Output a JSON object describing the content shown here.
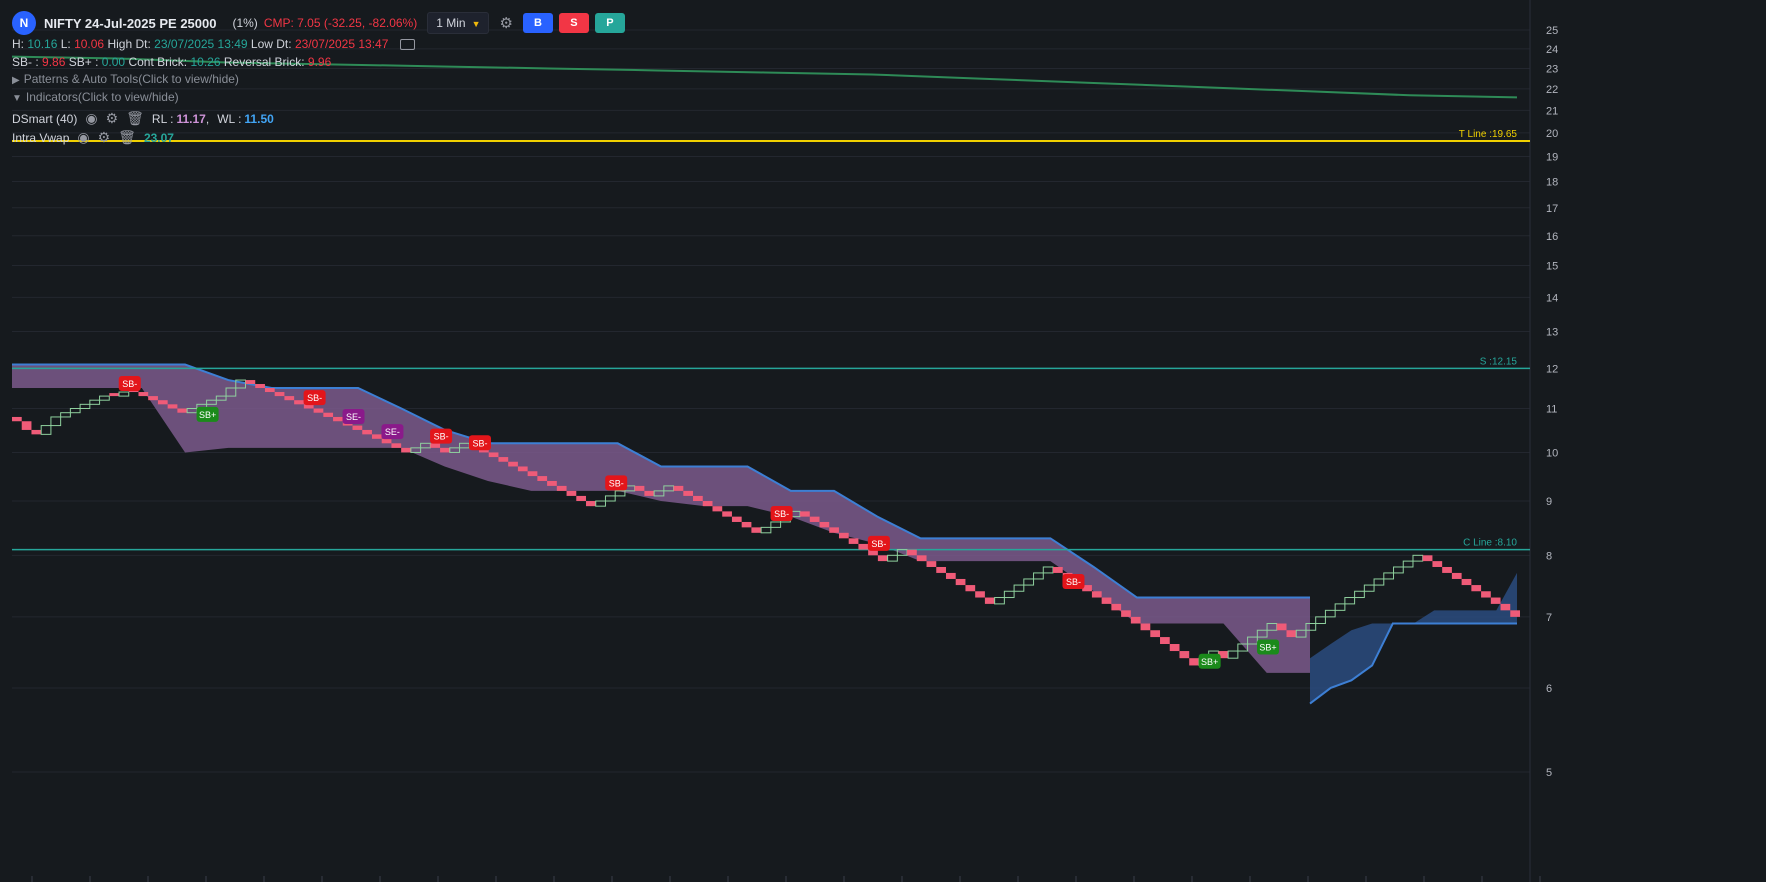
{
  "header": {
    "logo_letter": "N",
    "symbol": "NIFTY 24-Jul-2025 PE 25000",
    "percent": "(1%)",
    "cmp": "CMP: 7.05 (-32.25, -82.06%)",
    "timeframe": "1 Min",
    "buttons": [
      "B",
      "S",
      "P"
    ]
  },
  "stats": {
    "h_label": "H:",
    "h_value": "10.16",
    "l_label": "L:",
    "l_value": "10.06",
    "high_dt_label": "High Dt:",
    "high_dt_value": "23/07/2025 13:49",
    "low_dt_label": "Low Dt:",
    "low_dt_value": "23/07/2025 13:47"
  },
  "bricks": {
    "sb_minus_label": "SB- :",
    "sb_minus_value": "9.86",
    "sb_plus_label": "SB+ :",
    "sb_plus_value": "0.00",
    "cont_label": "Cont Brick:",
    "cont_value": "10.26",
    "rev_label": "Reversal Brick:",
    "rev_value": "9.96"
  },
  "panels": {
    "patterns": "Patterns & Auto Tools(Click to view/hide)",
    "indicators": "Indicators(Click to view/hide)"
  },
  "indicators": [
    {
      "name": "DSmart (40)",
      "rl_label": "RL :",
      "rl_value": "11.17",
      "wl_label": "WL :",
      "wl_value": "11.50"
    },
    {
      "name": "Intra Vwap",
      "value": "23.07"
    }
  ],
  "colors": {
    "up": "#8fd19e",
    "down": "#ef5b78",
    "band": "#7b5a8c",
    "band_edge": "#3d7fd4",
    "vwap": "#2e8b57",
    "t_line": "#f0d000",
    "s_line": "#26a69a",
    "c_line": "#26a69a"
  },
  "chart_data": {
    "type": "line",
    "y_axis": {
      "min": 5,
      "max": 25,
      "scale": "log",
      "ticks": [
        5,
        6,
        7,
        8,
        9,
        10,
        11,
        12,
        13,
        14,
        15,
        16,
        17,
        18,
        19,
        20,
        21,
        22,
        23,
        24,
        25
      ]
    },
    "levels": [
      {
        "label": "T Line :19.65",
        "value": 19.65
      },
      {
        "label": "S :12.15",
        "value": 12.0
      },
      {
        "label": "C Line :8.10",
        "value": 8.1
      }
    ],
    "vwap": [
      23.6,
      23.5,
      23.3,
      23.2,
      23.1,
      23.0,
      22.9,
      22.8,
      22.7,
      22.5,
      22.3,
      22.1,
      21.9,
      21.7,
      21.6
    ],
    "renko": [
      10.7,
      10.5,
      10.4,
      10.6,
      10.8,
      10.9,
      11.0,
      11.1,
      11.2,
      11.3,
      11.3,
      11.4,
      11.4,
      11.3,
      11.2,
      11.1,
      11.0,
      10.9,
      11.0,
      11.1,
      11.2,
      11.3,
      11.5,
      11.7,
      11.6,
      11.5,
      11.4,
      11.3,
      11.2,
      11.1,
      11.0,
      10.9,
      10.8,
      10.7,
      10.6,
      10.5,
      10.4,
      10.3,
      10.2,
      10.1,
      10.0,
      10.1,
      10.2,
      10.1,
      10.0,
      10.1,
      10.2,
      10.1,
      10.0,
      9.9,
      9.8,
      9.7,
      9.6,
      9.5,
      9.4,
      9.3,
      9.2,
      9.1,
      9.0,
      8.9,
      9.0,
      9.1,
      9.2,
      9.3,
      9.2,
      9.1,
      9.2,
      9.3,
      9.2,
      9.1,
      9.0,
      8.9,
      8.8,
      8.7,
      8.6,
      8.5,
      8.4,
      8.5,
      8.6,
      8.7,
      8.8,
      8.7,
      8.6,
      8.5,
      8.4,
      8.3,
      8.2,
      8.1,
      8.0,
      7.9,
      8.0,
      8.1,
      8.0,
      7.9,
      7.8,
      7.7,
      7.6,
      7.5,
      7.4,
      7.3,
      7.2,
      7.3,
      7.4,
      7.5,
      7.6,
      7.7,
      7.8,
      7.7,
      7.6,
      7.5,
      7.4,
      7.3,
      7.2,
      7.1,
      7.0,
      6.9,
      6.8,
      6.7,
      6.6,
      6.5,
      6.4,
      6.3,
      6.4,
      6.5,
      6.4,
      6.5,
      6.6,
      6.7,
      6.8,
      6.9,
      6.8,
      6.7,
      6.8,
      6.9,
      7.0,
      7.1,
      7.2,
      7.3,
      7.4,
      7.5,
      7.6,
      7.7,
      7.8,
      7.9,
      8.0,
      7.9,
      7.8,
      7.7,
      7.6,
      7.5,
      7.4,
      7.3,
      7.2,
      7.1,
      7.0
    ],
    "band_upper": [
      12.1,
      12.1,
      12.1,
      12.1,
      12.1,
      11.7,
      11.5,
      11.5,
      11.5,
      11.0,
      10.5,
      10.2,
      10.2,
      10.2,
      10.2,
      9.7,
      9.7,
      9.7,
      9.2,
      9.2,
      8.7,
      8.3,
      8.3,
      8.3,
      8.3,
      7.8,
      7.3,
      7.3,
      7.3,
      7.3,
      7.3
    ],
    "band_lower": [
      11.5,
      11.5,
      11.5,
      11.5,
      10.0,
      10.1,
      10.1,
      10.1,
      10.1,
      10.1,
      9.7,
      9.4,
      9.2,
      9.2,
      9.2,
      9.0,
      8.9,
      8.9,
      8.7,
      8.4,
      8.2,
      7.9,
      7.9,
      7.9,
      7.9,
      7.4,
      6.9,
      6.9,
      6.9,
      6.2,
      6.2
    ],
    "band2_upper": [
      6.4,
      6.6,
      6.8,
      6.9,
      6.9,
      6.9,
      7.1,
      7.1,
      7.1,
      7.1,
      7.7
    ],
    "band2_lower": [
      5.8,
      6.0,
      6.1,
      6.3,
      6.9,
      6.9,
      6.9,
      6.9,
      6.9,
      6.9,
      6.9
    ],
    "signals": [
      {
        "label": "SB-",
        "type": "sell",
        "index": 12,
        "value": 11.6
      },
      {
        "label": "SB+",
        "type": "buy",
        "index": 20,
        "value": 10.85
      },
      {
        "label": "SB-",
        "type": "sell",
        "index": 31,
        "value": 11.25
      },
      {
        "label": "SE-",
        "type": "exit",
        "index": 35,
        "value": 10.8
      },
      {
        "label": "SE-",
        "type": "exit",
        "index": 39,
        "value": 10.45
      },
      {
        "label": "SB-",
        "type": "sell",
        "index": 44,
        "value": 10.35
      },
      {
        "label": "SB-",
        "type": "sell",
        "index": 48,
        "value": 10.2
      },
      {
        "label": "SB-",
        "type": "sell",
        "index": 62,
        "value": 9.35
      },
      {
        "label": "SB-",
        "type": "sell",
        "index": 79,
        "value": 8.75
      },
      {
        "label": "SB-",
        "type": "sell",
        "index": 89,
        "value": 8.2
      },
      {
        "label": "SB-",
        "type": "sell",
        "index": 109,
        "value": 7.55
      },
      {
        "label": "SB+",
        "type": "buy",
        "index": 123,
        "value": 6.35
      },
      {
        "label": "SB+",
        "type": "buy",
        "index": 129,
        "value": 6.55
      }
    ]
  }
}
